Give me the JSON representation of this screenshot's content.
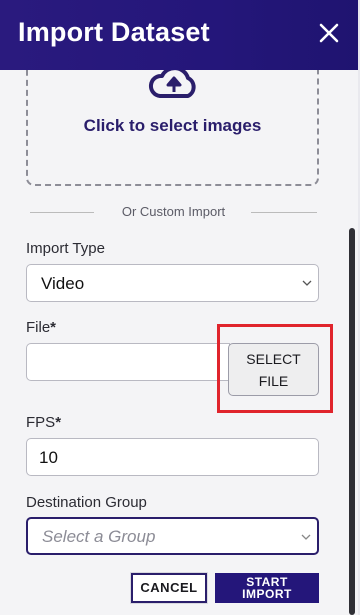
{
  "dialog": {
    "title": "Import Dataset",
    "close_icon": "close-icon",
    "accent_color": "#24167a"
  },
  "dropzone": {
    "icon": "cloud-upload-icon",
    "text": "Click to select images"
  },
  "divider_label": "Or Custom Import",
  "import_type": {
    "label": "Import Type",
    "value": "Video"
  },
  "file": {
    "label": "File",
    "required_mark": "*",
    "value": "",
    "button_line1": "SELECT",
    "button_line2": "FILE",
    "highlight_color": "#e0242c"
  },
  "fps": {
    "label": "FPS",
    "required_mark": "*",
    "value": "10"
  },
  "destination_group": {
    "label": "Destination Group",
    "placeholder": "Select a Group"
  },
  "actions": {
    "cancel": "CANCEL",
    "start_line1": "START",
    "start_line2": "IMPORT"
  }
}
